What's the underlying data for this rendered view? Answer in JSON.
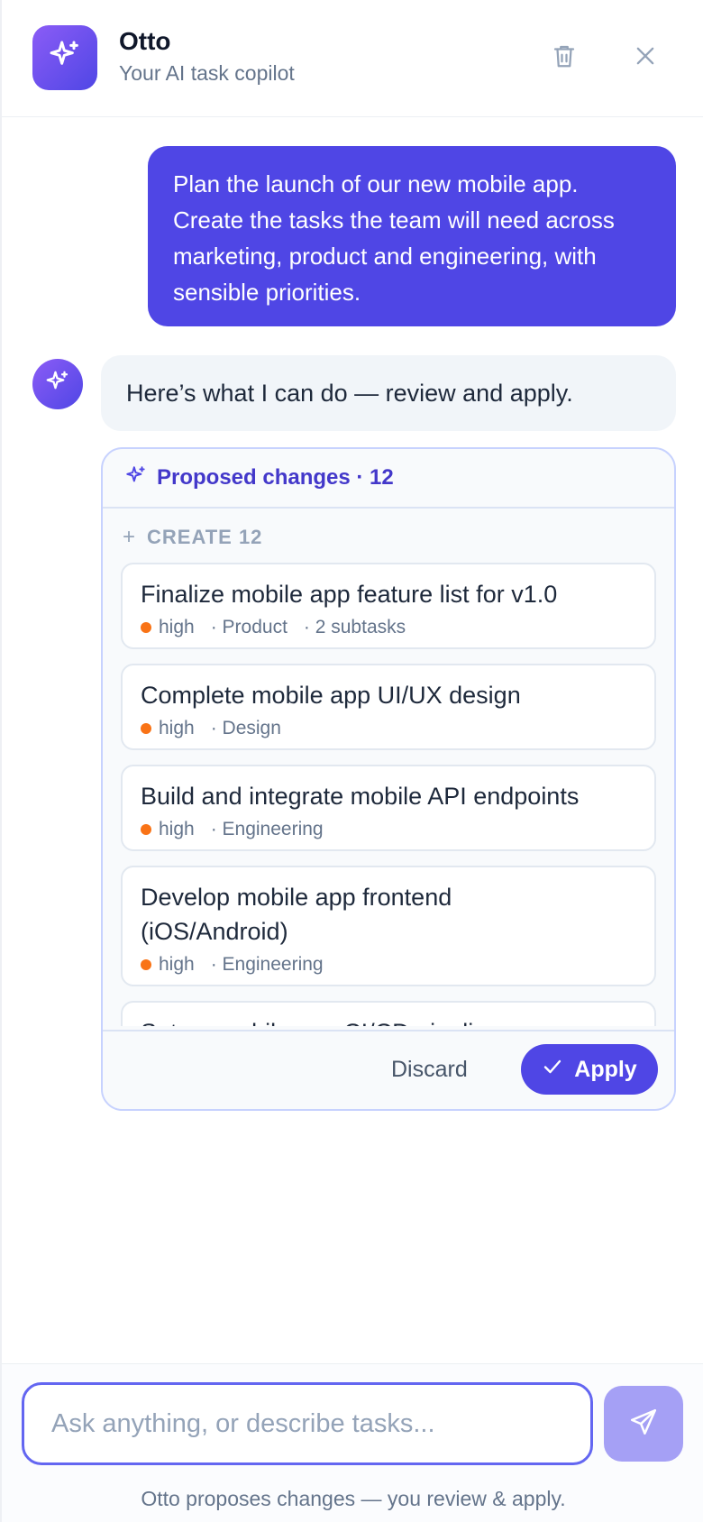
{
  "header": {
    "title": "Otto",
    "subtitle": "Your AI task copilot",
    "logo_icon": "sparkles-icon",
    "actions": [
      {
        "icon": "trash-icon"
      },
      {
        "icon": "close-icon"
      }
    ]
  },
  "conversation": {
    "user_message": "Plan the launch of our new mobile app. Create the tasks the team will need across marketing, product and engineering, with sensible priorities.",
    "assistant_message": "Here’s what I can do — review and apply."
  },
  "proposal": {
    "header_label": "Proposed changes · 12",
    "section_label": "CREATE 12",
    "section_icon": "plus-icon",
    "tasks": [
      {
        "title": "Finalize mobile app feature list for v1.0",
        "priority": "high",
        "area": "· Product",
        "extra": "· 2 subtasks"
      },
      {
        "title": "Complete mobile app UI/UX design",
        "priority": "high",
        "area": "· Design",
        "extra": ""
      },
      {
        "title": "Build and integrate mobile API endpoints",
        "priority": "high",
        "area": "· Engineering",
        "extra": ""
      },
      {
        "title": "Develop mobile app frontend (iOS/Android)",
        "priority": "high",
        "area": "· Engineering",
        "extra": ""
      },
      {
        "title": "Set up mobile app CI/CD pipeline",
        "priority": "",
        "area": "",
        "extra": ""
      }
    ],
    "discard_label": "Discard",
    "apply_label": "Apply"
  },
  "composer": {
    "placeholder": "Ask anything, or describe tasks...",
    "value": "",
    "footnote": "Otto proposes changes — you review & apply."
  },
  "colors": {
    "accent": "#4f46e5",
    "priority_high": "#f97316",
    "send_disabled": "#a5a0f5"
  }
}
